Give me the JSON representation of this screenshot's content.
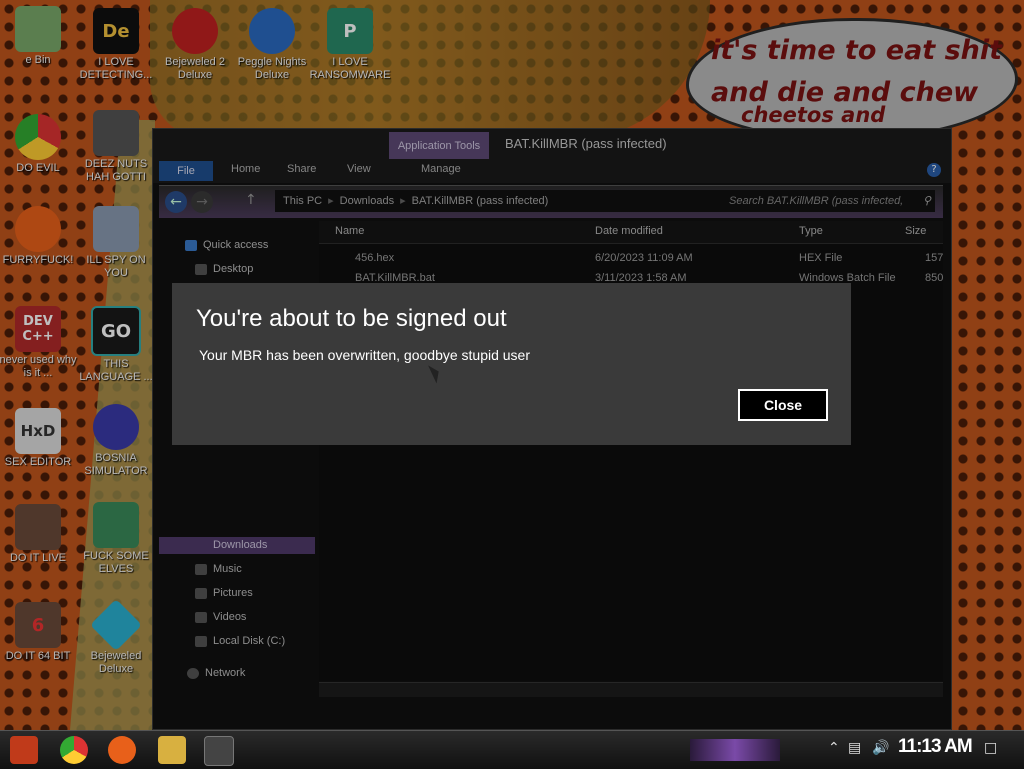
{
  "speech_bubble": {
    "line1": "it's time to eat shit",
    "line2": "and die and chew",
    "line3": "cheetos and"
  },
  "desktop_icons": [
    {
      "label": "e Bin"
    },
    {
      "label": "I LOVE DETECTING..."
    },
    {
      "label": "Bejeweled 2 Deluxe"
    },
    {
      "label": "Peggle Nights Deluxe"
    },
    {
      "label": "I LOVE RANSOMWARE"
    },
    {
      "label": "DO EVIL"
    },
    {
      "label": "DEEZ NUTS HAH GOTTI"
    },
    {
      "label": "FURRYFUCK!"
    },
    {
      "label": "ILL SPY ON YOU"
    },
    {
      "label": "never used why is it ..."
    },
    {
      "label": "THIS LANGUAGE ..."
    },
    {
      "label": "SEX EDITOR"
    },
    {
      "label": "BOSNIA SIMULATOR"
    },
    {
      "label": "DO IT LIVE"
    },
    {
      "label": "FUCK SOME ELVES"
    },
    {
      "label": "DO IT 64 BIT"
    },
    {
      "label": "Bejeweled Deluxe"
    }
  ],
  "icon_glyphs": {
    "dev": "DEV C++",
    "go": "GO",
    "hxd": "HxD",
    "de": "De",
    "six": "6"
  },
  "explorer": {
    "window_title": "BAT.KillMBR (pass infected)",
    "app_tools": "Application Tools",
    "tabs": {
      "file": "File",
      "home": "Home",
      "share": "Share",
      "view": "View",
      "manage": "Manage"
    },
    "breadcrumbs": [
      "This PC",
      "Downloads",
      "BAT.KillMBR (pass infected)"
    ],
    "search_placeholder": "Search BAT.KillMBR (pass infected,",
    "nav": {
      "quick_access": "Quick access",
      "desktop": "Desktop",
      "downloads": "Downloads",
      "music": "Music",
      "pictures": "Pictures",
      "videos": "Videos",
      "local_disk": "Local Disk (C:)",
      "network": "Network"
    },
    "columns": {
      "name": "Name",
      "date": "Date modified",
      "type": "Type",
      "size": "Size"
    },
    "files": [
      {
        "name": "456.hex",
        "date": "6/20/2023 11:09 AM",
        "type": "HEX File",
        "size": "157"
      },
      {
        "name": "BAT.KillMBR.bat",
        "date": "3/11/2023 1:58 AM",
        "type": "Windows Batch File",
        "size": "850"
      }
    ]
  },
  "dialog": {
    "title": "You're about to be signed out",
    "message": "Your MBR has been overwritten, goodbye stupid user",
    "close_label": "Close"
  },
  "taskbar": {
    "time": "11:13 AM"
  },
  "colors": {
    "dialog_bg": "#3a3a3a",
    "accent_purple": "#5e4a76",
    "file_tab": "#1f4f8f"
  }
}
